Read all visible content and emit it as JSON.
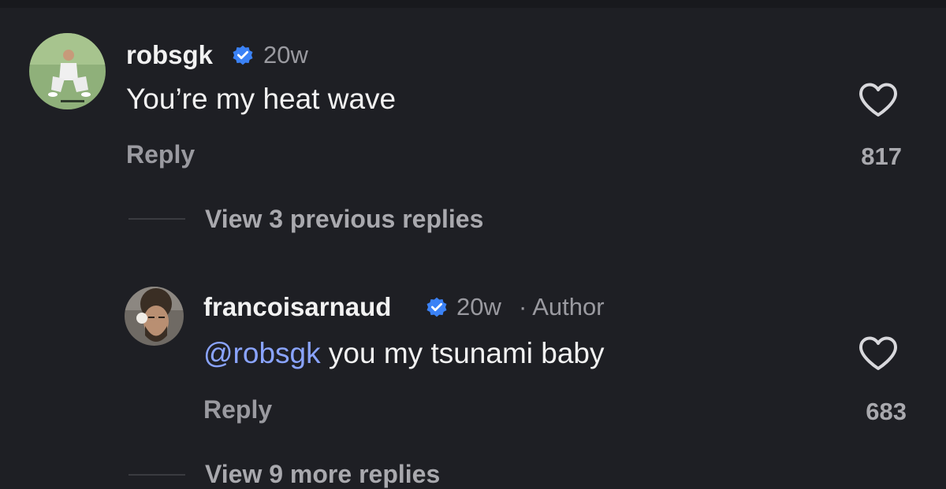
{
  "comments": [
    {
      "username": "robsgk",
      "verified": true,
      "time": "20w",
      "text": "You’re my heat wave",
      "reply_label": "Reply",
      "likes": "817"
    },
    {
      "username": "francoisarnaud",
      "verified": true,
      "time": "20w",
      "author_tag": "· Author",
      "mention": "@robsgk",
      "text": " you my tsunami baby",
      "reply_label": "Reply",
      "likes": "683"
    }
  ],
  "thread": {
    "view_previous": "View 3 previous replies",
    "view_more": "View 9 more replies"
  },
  "colors": {
    "background": "#1e1f24",
    "verified_badge": "#3b82f6",
    "mention": "#8aa4ff",
    "secondary_text": "#9a9aa0"
  }
}
